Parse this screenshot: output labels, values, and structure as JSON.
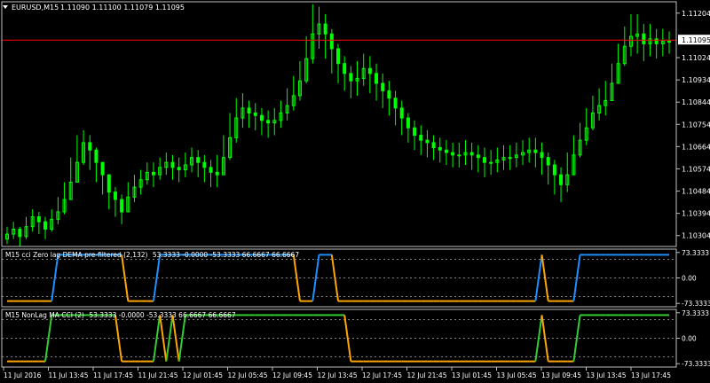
{
  "window": {
    "title": "EURUSD,M15",
    "ohlc": "1.11090 1.11100 1.11079 1.11095",
    "menu_icon": "triangle-down-icon"
  },
  "colors": {
    "background": "#000000",
    "candle": "#00ff00",
    "frame": "#c0c0c0",
    "grid": "#808080",
    "price_line": "#ff0000",
    "price_tag_bg": "#ffffff",
    "price_tag_text": "#000000",
    "ind1_up": "#1e90ff",
    "ind1_down": "#ffa500",
    "ind2_up": "#32cd32",
    "ind2_down": "#ffa500",
    "level_line": "#b0b0b0"
  },
  "chart_data": [
    {
      "type": "candlestick",
      "symbol": "EURUSD",
      "timeframe": "M15",
      "current_price": "1.11095",
      "y_ticks": [
        "1.11204",
        "1.11024",
        "1.10934",
        "1.10844",
        "1.10754",
        "1.10664",
        "1.10574",
        "1.10484",
        "1.10394",
        "1.10304"
      ],
      "ylim": [
        1.1026,
        1.1125
      ],
      "x_ticks": [
        "11 Jul 2016",
        "11 Jul 13:45",
        "11 Jul 17:45",
        "11 Jul 21:45",
        "12 Jul 01:45",
        "12 Jul 05:45",
        "12 Jul 09:45",
        "12 Jul 13:45",
        "12 Jul 17:45",
        "12 Jul 21:45",
        "13 Jul 01:45",
        "13 Jul 05:45",
        "13 Jul 09:45",
        "13 Jul 13:45",
        "13 Jul 17:45"
      ],
      "series": [
        {
          "name": "close",
          "values": [
            1.1031,
            1.1033,
            1.103,
            1.1034,
            1.1038,
            1.1036,
            1.1033,
            1.1037,
            1.104,
            1.1045,
            1.1052,
            1.106,
            1.1068,
            1.1065,
            1.106,
            1.1055,
            1.1048,
            1.1045,
            1.104,
            1.1046,
            1.105,
            1.1053,
            1.1056,
            1.1055,
            1.1058,
            1.106,
            1.1058,
            1.1057,
            1.1059,
            1.1062,
            1.106,
            1.1058,
            1.1056,
            1.1055,
            1.1062,
            1.107,
            1.1078,
            1.1082,
            1.108,
            1.1079,
            1.1077,
            1.1076,
            1.1077,
            1.108,
            1.1083,
            1.1087,
            1.1093,
            1.1102,
            1.1112,
            1.1116,
            1.1112,
            1.1106,
            1.11,
            1.1096,
            1.1093,
            1.1094,
            1.1098,
            1.1096,
            1.1092,
            1.1089,
            1.1086,
            1.1082,
            1.1078,
            1.1074,
            1.1071,
            1.1069,
            1.1068,
            1.1066,
            1.1065,
            1.1064,
            1.1063,
            1.1063,
            1.1064,
            1.1063,
            1.1062,
            1.106,
            1.106,
            1.1061,
            1.1062,
            1.1062,
            1.1063,
            1.1064,
            1.1065,
            1.1064,
            1.1062,
            1.1059,
            1.1055,
            1.1051,
            1.1055,
            1.1063,
            1.1069,
            1.1074,
            1.108,
            1.1083,
            1.1085,
            1.1092,
            1.11,
            1.1107,
            1.1111,
            1.1112,
            1.1108,
            1.111,
            1.1108,
            1.1109,
            1.1109
          ]
        },
        {
          "name": "high",
          "values": [
            1.1034,
            1.1036,
            1.1034,
            1.1038,
            1.1041,
            1.104,
            1.1038,
            1.1041,
            1.1046,
            1.1052,
            1.1062,
            1.1071,
            1.1073,
            1.1071,
            1.1066,
            1.1059,
            1.1054,
            1.105,
            1.1047,
            1.1052,
            1.1055,
            1.1057,
            1.106,
            1.106,
            1.1062,
            1.1064,
            1.1063,
            1.1062,
            1.1064,
            1.1066,
            1.1065,
            1.1063,
            1.1061,
            1.1063,
            1.1071,
            1.108,
            1.1086,
            1.1088,
            1.1085,
            1.1084,
            1.1082,
            1.1081,
            1.1082,
            1.1085,
            1.109,
            1.1095,
            1.1101,
            1.1111,
            1.1124,
            1.1123,
            1.112,
            1.1114,
            1.1108,
            1.1103,
            1.1099,
            1.1101,
            1.1104,
            1.1103,
            1.11,
            1.1096,
            1.1093,
            1.1089,
            1.1085,
            1.108,
            1.1077,
            1.1075,
            1.1073,
            1.1071,
            1.107,
            1.1069,
            1.1068,
            1.1068,
            1.1069,
            1.1068,
            1.1067,
            1.1066,
            1.1065,
            1.1066,
            1.1067,
            1.1067,
            1.1068,
            1.1069,
            1.107,
            1.107,
            1.1068,
            1.1064,
            1.1061,
            1.1058,
            1.1064,
            1.1071,
            1.1076,
            1.1082,
            1.1087,
            1.109,
            1.1093,
            1.11,
            1.1108,
            1.1115,
            1.112,
            1.112,
            1.1116,
            1.1116,
            1.1114,
            1.1114,
            1.1113
          ]
        },
        {
          "name": "low",
          "values": [
            1.1027,
            1.1029,
            1.1026,
            1.1029,
            1.1032,
            1.1031,
            1.1029,
            1.1032,
            1.1035,
            1.1039,
            1.1045,
            1.1052,
            1.1059,
            1.1057,
            1.1052,
            1.1047,
            1.1041,
            1.1038,
            1.1035,
            1.104,
            1.1044,
            1.1047,
            1.1051,
            1.105,
            1.1053,
            1.1055,
            1.1053,
            1.1052,
            1.1054,
            1.1056,
            1.1054,
            1.1052,
            1.105,
            1.105,
            1.1055,
            1.1061,
            1.1068,
            1.1074,
            1.1074,
            1.1073,
            1.1071,
            1.107,
            1.1071,
            1.1074,
            1.1077,
            1.1081,
            1.1085,
            1.1092,
            1.11,
            1.1106,
            1.1102,
            1.1096,
            1.1092,
            1.1089,
            1.1086,
            1.1087,
            1.1091,
            1.1088,
            1.1085,
            1.1082,
            1.1079,
            1.1075,
            1.1071,
            1.1068,
            1.1065,
            1.1063,
            1.1062,
            1.1061,
            1.106,
            1.1059,
            1.1058,
            1.1058,
            1.1059,
            1.1057,
            1.1056,
            1.1054,
            1.1055,
            1.1056,
            1.1057,
            1.1057,
            1.1058,
            1.1059,
            1.106,
            1.1058,
            1.1055,
            1.1051,
            1.1047,
            1.1044,
            1.1048,
            1.1055,
            1.1062,
            1.1067,
            1.1073,
            1.1077,
            1.1079,
            1.1085,
            1.1092,
            1.1099,
            1.1103,
            1.1104,
            1.1101,
            1.1103,
            1.1102,
            1.1103,
            1.1104
          ]
        }
      ]
    },
    {
      "type": "line",
      "title": "M15 cci Zero lag DEMA pre-filtered (2,132)",
      "values_label": "53.3333 -0.0000 -53.3333 66.6667 66.6667",
      "y_ticks": [
        "73.3333",
        "0.00",
        "-73.3333"
      ],
      "ylim": [
        -83,
        83
      ],
      "levels": [
        53.3333,
        0,
        -53.3333
      ],
      "series": [
        {
          "values": [
            -66.67,
            -66.67,
            -66.67,
            -66.67,
            -66.67,
            -66.67,
            -66.67,
            -66.67,
            66.67,
            66.67,
            66.67,
            66.67,
            66.67,
            66.67,
            66.67,
            66.67,
            66.67,
            66.67,
            66.67,
            -66.67,
            -66.67,
            -66.67,
            -66.67,
            -66.67,
            66.67,
            66.67,
            66.67,
            66.67,
            66.67,
            66.67,
            66.67,
            66.67,
            66.67,
            66.67,
            66.67,
            66.67,
            66.67,
            66.67,
            66.67,
            66.67,
            66.67,
            66.67,
            66.67,
            66.67,
            66.67,
            66.67,
            -66.67,
            -66.67,
            -66.67,
            66.67,
            66.67,
            66.67,
            -66.67,
            -66.67,
            -66.67,
            -66.67,
            -66.67,
            -66.67,
            -66.67,
            -66.67,
            -66.67,
            -66.67,
            -66.67,
            -66.67,
            -66.67,
            -66.67,
            -66.67,
            -66.67,
            -66.67,
            -66.67,
            -66.67,
            -66.67,
            -66.67,
            -66.67,
            -66.67,
            -66.67,
            -66.67,
            -66.67,
            -66.67,
            -66.67,
            -66.67,
            -66.67,
            -66.67,
            -66.67,
            66.67,
            -66.67,
            -66.67,
            -66.67,
            -66.67,
            -66.67,
            66.67,
            66.67,
            66.67,
            66.67,
            66.67,
            66.67,
            66.67,
            66.67,
            66.67,
            66.67,
            66.67,
            66.67,
            66.67,
            66.67,
            66.67
          ]
        }
      ]
    },
    {
      "type": "line",
      "title": "M15 NonLag MA CCI (2)",
      "values_label": "53.3333 -0.0000 -53.3333 66.6667 66.6667",
      "y_ticks": [
        "73.3333",
        "0.00",
        "-73.3333"
      ],
      "ylim": [
        -83,
        83
      ],
      "levels": [
        53.3333,
        0,
        -53.3333
      ],
      "series": [
        {
          "values": [
            -66.67,
            -66.67,
            -66.67,
            -66.67,
            -66.67,
            -66.67,
            -66.67,
            66.67,
            66.67,
            66.67,
            66.67,
            66.67,
            66.67,
            66.67,
            66.67,
            66.67,
            66.67,
            66.67,
            -66.67,
            -66.67,
            -66.67,
            -66.67,
            -66.67,
            -66.67,
            66.67,
            -66.67,
            66.67,
            -66.67,
            66.67,
            66.67,
            66.67,
            66.67,
            66.67,
            66.67,
            66.67,
            66.67,
            66.67,
            66.67,
            66.67,
            66.67,
            66.67,
            66.67,
            66.67,
            66.67,
            66.67,
            66.67,
            66.67,
            66.67,
            66.67,
            66.67,
            66.67,
            66.67,
            66.67,
            66.67,
            -66.67,
            -66.67,
            -66.67,
            -66.67,
            -66.67,
            -66.67,
            -66.67,
            -66.67,
            -66.67,
            -66.67,
            -66.67,
            -66.67,
            -66.67,
            -66.67,
            -66.67,
            -66.67,
            -66.67,
            -66.67,
            -66.67,
            -66.67,
            -66.67,
            -66.67,
            -66.67,
            -66.67,
            -66.67,
            -66.67,
            -66.67,
            -66.67,
            -66.67,
            -66.67,
            66.67,
            -66.67,
            -66.67,
            -66.67,
            -66.67,
            -66.67,
            66.67,
            66.67,
            66.67,
            66.67,
            66.67,
            66.67,
            66.67,
            66.67,
            66.67,
            66.67,
            66.67,
            66.67,
            66.67,
            66.67,
            66.67
          ]
        }
      ]
    }
  ]
}
